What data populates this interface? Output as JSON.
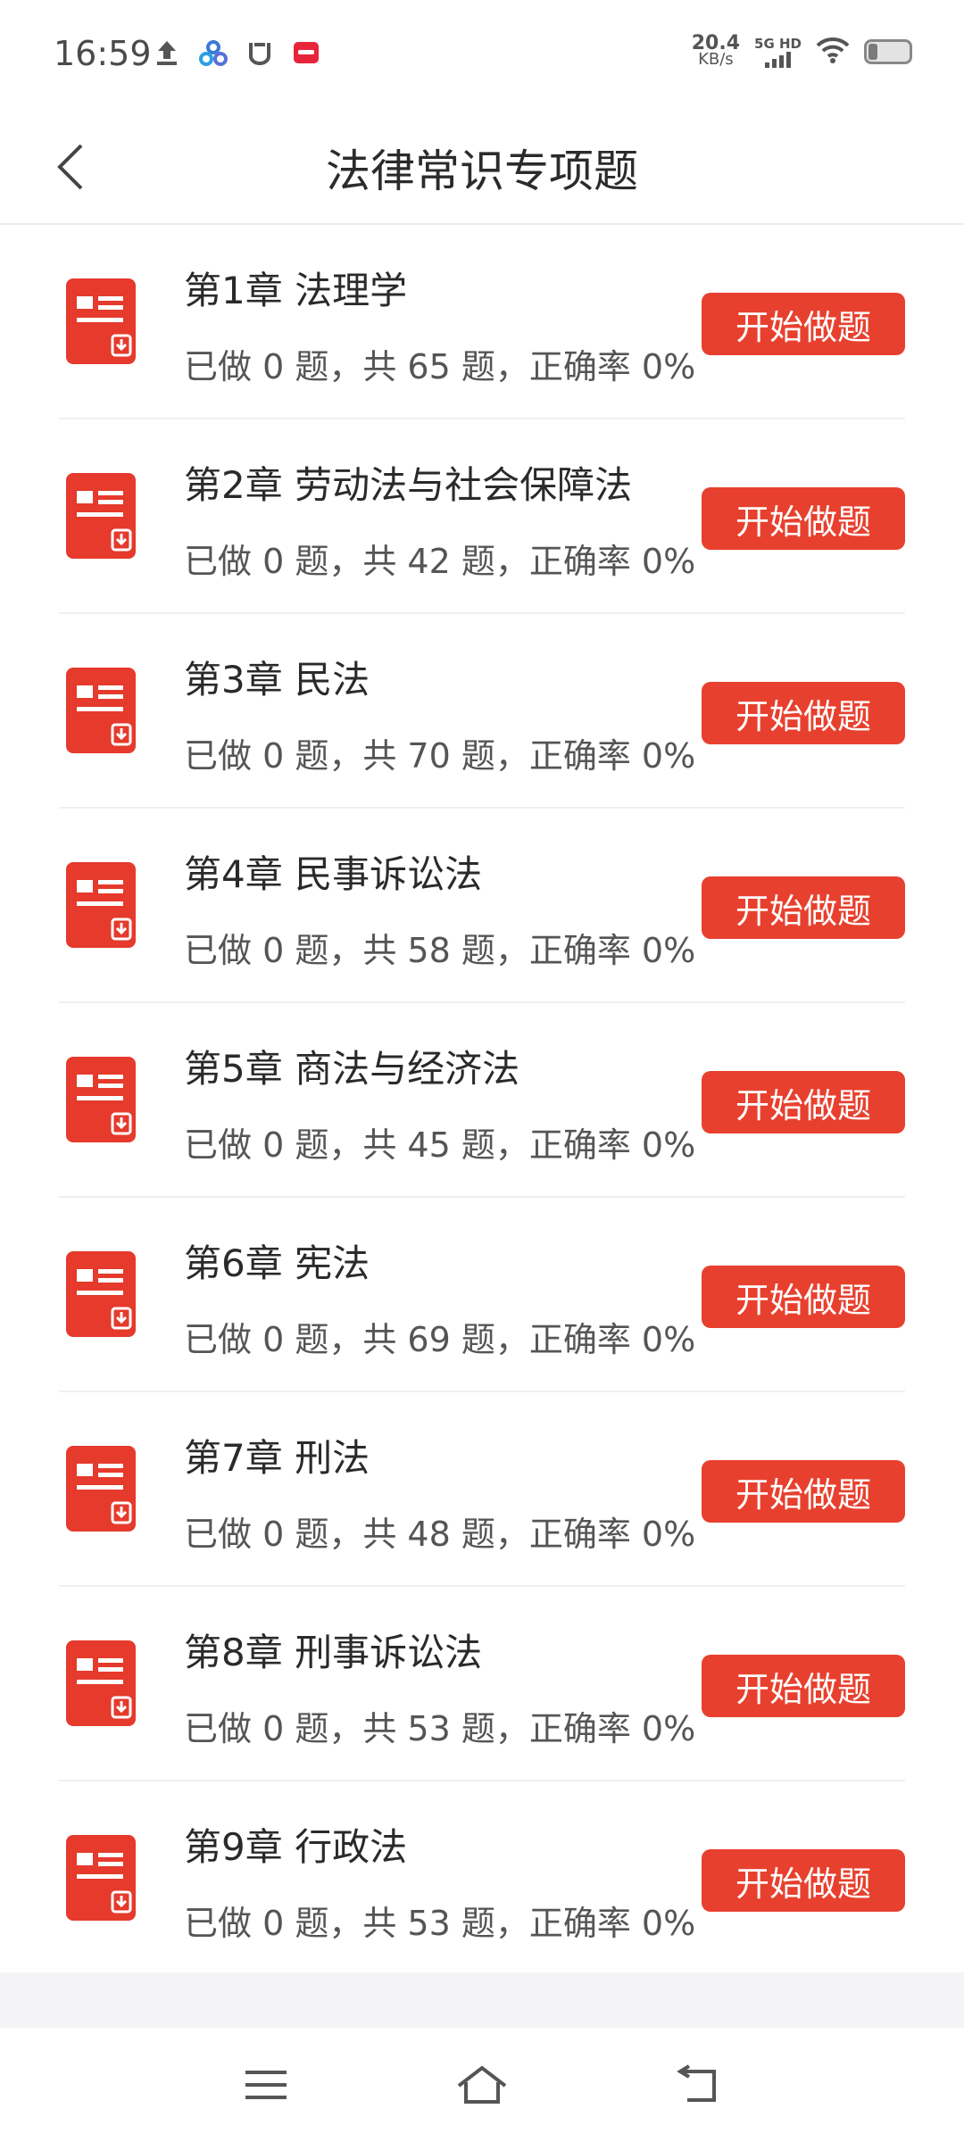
{
  "status_bar": {
    "time": "16:59",
    "net_speed_value": "20.4",
    "net_speed_unit": "KB/s",
    "signal_label": "5G HD"
  },
  "header": {
    "title": "法律常识专项题"
  },
  "colors": {
    "accent": "#e8402e",
    "icon_red": "#e53a2c"
  },
  "chapters": [
    {
      "title": "第1章 法理学",
      "stats": "已做 0 题，共 65 题，正确率 0%",
      "button": "开始做题"
    },
    {
      "title": "第2章 劳动法与社会保障法",
      "stats": "已做 0 题，共 42 题，正确率 0%",
      "button": "开始做题"
    },
    {
      "title": "第3章 民法",
      "stats": "已做 0 题，共 70 题，正确率 0%",
      "button": "开始做题"
    },
    {
      "title": "第4章 民事诉讼法",
      "stats": "已做 0 题，共 58 题，正确率 0%",
      "button": "开始做题"
    },
    {
      "title": "第5章 商法与经济法",
      "stats": "已做 0 题，共 45 题，正确率 0%",
      "button": "开始做题"
    },
    {
      "title": "第6章 宪法",
      "stats": "已做 0 题，共 69 题，正确率 0%",
      "button": "开始做题"
    },
    {
      "title": "第7章 刑法",
      "stats": "已做 0 题，共 48 题，正确率 0%",
      "button": "开始做题"
    },
    {
      "title": "第8章 刑事诉讼法",
      "stats": "已做 0 题，共 53 题，正确率 0%",
      "button": "开始做题"
    },
    {
      "title": "第9章 行政法",
      "stats": "已做 0 题，共 53 题，正确率 0%",
      "button": "开始做题"
    }
  ],
  "nav_bar": {
    "icons": [
      "menu-icon",
      "home-icon",
      "back-icon"
    ]
  }
}
